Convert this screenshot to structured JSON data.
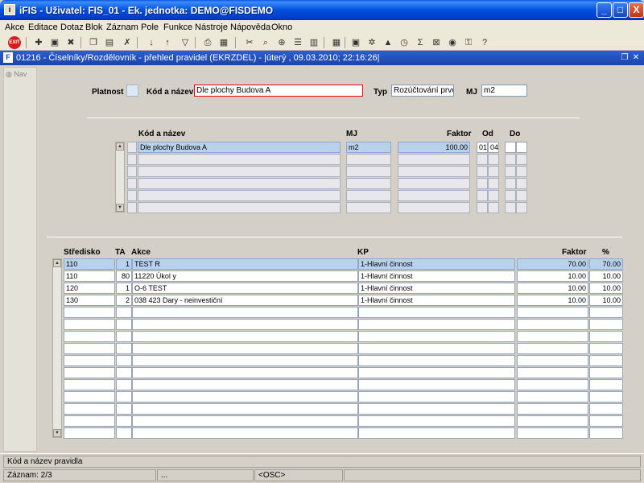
{
  "window": {
    "title": "iFIS - Uživatel: FIS_01 - Ek. jednotka: DEMO@FISDEMO",
    "min": "_",
    "max": "□",
    "close": "X"
  },
  "menu": [
    "Akce",
    "Editace",
    "Dotaz",
    "Blok",
    "Záznam",
    "Pole",
    "Funkce",
    "Nástroje",
    "Nápověda",
    "Okno"
  ],
  "toolbar": {
    "exit_label": "EXIT"
  },
  "child": {
    "title": "01216 - Číselníky/Rozdělovník - přehled pravidel (EKRZDEL) - |úterý , 09.03.2010; 22:16:26|"
  },
  "nav": {
    "label": "Nav"
  },
  "header_form": {
    "platnost_label": "Platnost",
    "platnost_value": "",
    "kod_label": "Kód a název",
    "kod_value": "Dle plochy Budova A",
    "typ_label": "Typ",
    "typ_value": "Rozúčtování prvotn",
    "mj_label": "MJ",
    "mj_value": "m2"
  },
  "upper_table": {
    "headers": {
      "kod": "Kód a název",
      "mj": "MJ",
      "faktor": "Faktor",
      "od": "Od",
      "do": "Do"
    },
    "rows": [
      {
        "kod": "Dle plochy Budova A",
        "mj": "m2",
        "faktor": "100.00",
        "od": "01",
        "od2": "04",
        "do": "",
        "do2": ""
      }
    ]
  },
  "lower_table": {
    "headers": {
      "stredisko": "Středisko",
      "ta": "TA",
      "akce": "Akce",
      "kp": "KP",
      "faktor": "Faktor",
      "pct": "%"
    },
    "rows": [
      {
        "stredisko": "110",
        "ta": "1",
        "akce": "TEST R",
        "kp": "1-Hlavní činnost",
        "faktor": "70.00",
        "pct": "70.00"
      },
      {
        "stredisko": "110",
        "ta": "80",
        "akce": "11220 Úkol y",
        "kp": "1-Hlavní činnost",
        "faktor": "10.00",
        "pct": "10.00"
      },
      {
        "stredisko": "120",
        "ta": "1",
        "akce": "O-6 TEST",
        "kp": "1-Hlavní činnost",
        "faktor": "10.00",
        "pct": "10.00"
      },
      {
        "stredisko": "130",
        "ta": "2",
        "akce": "038 423 Dary - neinvestiční",
        "kp": "1-Hlavní činnost",
        "faktor": "10.00",
        "pct": "10.00"
      }
    ]
  },
  "status": {
    "message": "Kód a název pravidla",
    "record": "Záznam: 2/3",
    "seg2": "...",
    "mode": "<OSC>"
  }
}
